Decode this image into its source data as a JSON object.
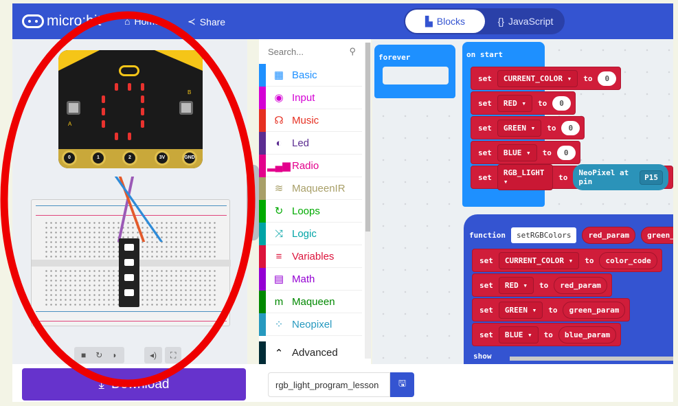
{
  "header": {
    "logo": "micro:bit",
    "home_label": "Home",
    "share_label": "Share",
    "tabs": [
      {
        "label": "Blocks",
        "active": true
      },
      {
        "label": "JavaScript",
        "active": false
      }
    ],
    "background": "#3454d1"
  },
  "simulator": {
    "pins": [
      "0",
      "1",
      "2",
      "3V",
      "GND"
    ],
    "buttons": [
      "A",
      "B"
    ],
    "controls": [
      "stop-icon",
      "restart-icon",
      "slow-motion-icon",
      "mute-icon",
      "fullscreen-icon"
    ]
  },
  "toolbox": {
    "search_placeholder": "Search...",
    "categories": [
      {
        "label": "Basic",
        "icon": "grid-icon",
        "glyph": "▦",
        "color": "#1e90ff"
      },
      {
        "label": "Input",
        "icon": "target-icon",
        "glyph": "◉",
        "color": "#d400d4"
      },
      {
        "label": "Music",
        "icon": "headphones-icon",
        "glyph": "☊",
        "color": "#e63022"
      },
      {
        "label": "Led",
        "icon": "toggle-icon",
        "glyph": "◐",
        "color": "#5c2d91"
      },
      {
        "label": "Radio",
        "icon": "signal-icon",
        "glyph": "▂▄▆",
        "color": "#e3008c"
      },
      {
        "label": "MaqueenIR",
        "icon": "wifi-icon",
        "glyph": "≋",
        "color": "#a89f68"
      },
      {
        "label": "Loops",
        "icon": "loop-icon",
        "glyph": "↻",
        "color": "#00aa00"
      },
      {
        "label": "Logic",
        "icon": "shuffle-icon",
        "glyph": "⤨",
        "color": "#00a4a6"
      },
      {
        "label": "Variables",
        "icon": "lines-icon",
        "glyph": "≡",
        "color": "#dc143c"
      },
      {
        "label": "Math",
        "icon": "calculator-icon",
        "glyph": "▤",
        "color": "#9400d3"
      },
      {
        "label": "Maqueen",
        "icon": "m-icon",
        "glyph": "m",
        "color": "#008800"
      },
      {
        "label": "Neopixel",
        "icon": "dots-circle-icon",
        "glyph": "⁘",
        "color": "#2699bf"
      }
    ],
    "advanced": {
      "label": "Advanced",
      "color": "#002b36"
    }
  },
  "workspace": {
    "forever": "forever",
    "on_start": {
      "title": "on start",
      "rows": [
        {
          "kw": "set",
          "var": "CURRENT_COLOR ▾",
          "to": "to",
          "value": "0"
        },
        {
          "kw": "set",
          "var": "RED ▾",
          "to": "to",
          "value": "0"
        },
        {
          "kw": "set",
          "var": "GREEN ▾",
          "to": "to",
          "value": "0"
        },
        {
          "kw": "set",
          "var": "BLUE ▾",
          "to": "to",
          "value": "0"
        },
        {
          "kw": "set",
          "var": "RGB_LIGHT ▾",
          "to": "to",
          "neopixel": "NeoPixel at pin",
          "pin": "P15"
        }
      ]
    },
    "function": {
      "kw": "function",
      "name": "setRGBColors",
      "params": [
        "red_param",
        "green_pa"
      ],
      "rows": [
        {
          "kw": "set",
          "var": "CURRENT_COLOR ▾",
          "to": "to",
          "value": "color_code"
        },
        {
          "kw": "set",
          "var": "RED ▾",
          "to": "to",
          "value": "red_param"
        },
        {
          "kw": "set",
          "var": "GREEN ▾",
          "to": "to",
          "value": "green_param"
        },
        {
          "kw": "set",
          "var": "BLUE ▾",
          "to": "to",
          "value": "blue_param"
        }
      ],
      "show": "show"
    }
  },
  "bottom": {
    "download_label": "Download",
    "project_name": "rgb_light_program_lesson"
  },
  "annotation": {
    "color": "#ee0000"
  }
}
